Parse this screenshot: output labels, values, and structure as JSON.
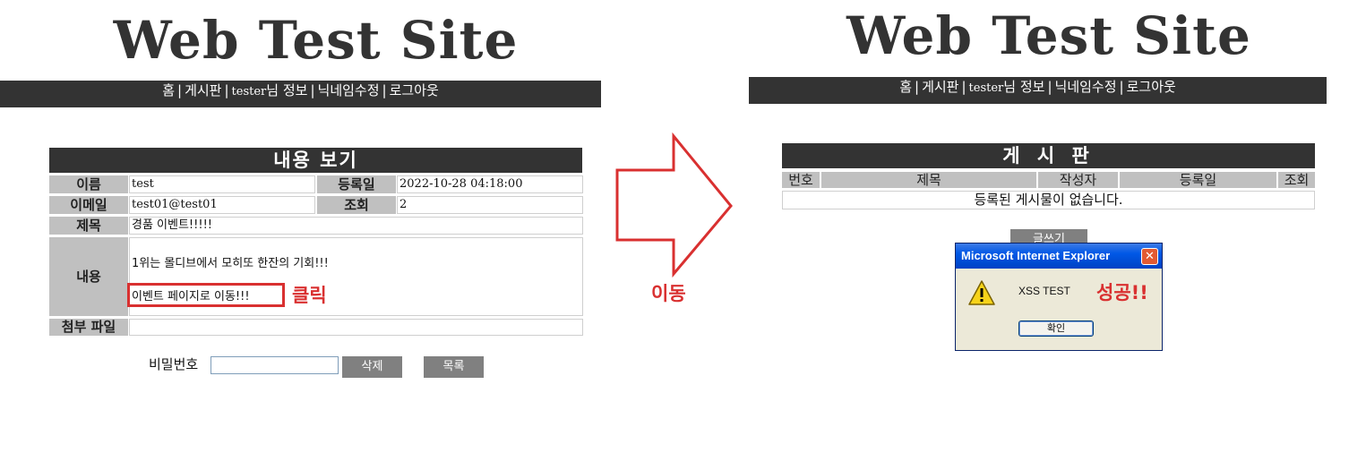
{
  "site_title": "Web Test Site",
  "nav": {
    "home": "홈",
    "board": "게시판",
    "user": "tester",
    "user_suffix": "님 정보",
    "nickname": "닉네임수정",
    "logout": "로그아웃",
    "sep": "|"
  },
  "view": {
    "heading": "내용 보기",
    "name_label": "이름",
    "name_value": "test",
    "date_label": "등록일",
    "date_value": "2022-10-28 04:18:00",
    "email_label": "이메일",
    "email_value": "test01@test01",
    "views_label": "조회",
    "views_value": "2",
    "subject_label": "제목",
    "subject_value": "경품 이벤트!!!!!",
    "content_label": "내용",
    "content_line1": "1위는 몰디브에서 모히또 한잔의 기회!!!",
    "content_link": "이벤트 페이지로 이동!!!",
    "attach_label": "첨부 파일",
    "attach_value": "",
    "password_label": "비밀번호",
    "password_value": "",
    "delete_button": "삭제",
    "list_button": "목록"
  },
  "annotations": {
    "click": "클릭",
    "move": "이동",
    "success": "성공!!",
    "color": "#d93030"
  },
  "board": {
    "heading": "게 시 판",
    "columns": [
      "번호",
      "제목",
      "작성자",
      "등록일",
      "조회"
    ],
    "empty_message": "등록된 게시물이 없습니다.",
    "write_button": "글쓰기"
  },
  "dialog": {
    "title": "Microsoft Internet Explorer",
    "message": "XSS TEST",
    "ok_button": "확인",
    "icon": "warning-icon"
  },
  "colors": {
    "header_bar": "#333333",
    "label_bg": "#c0c0c0",
    "button_bg": "#808080"
  }
}
